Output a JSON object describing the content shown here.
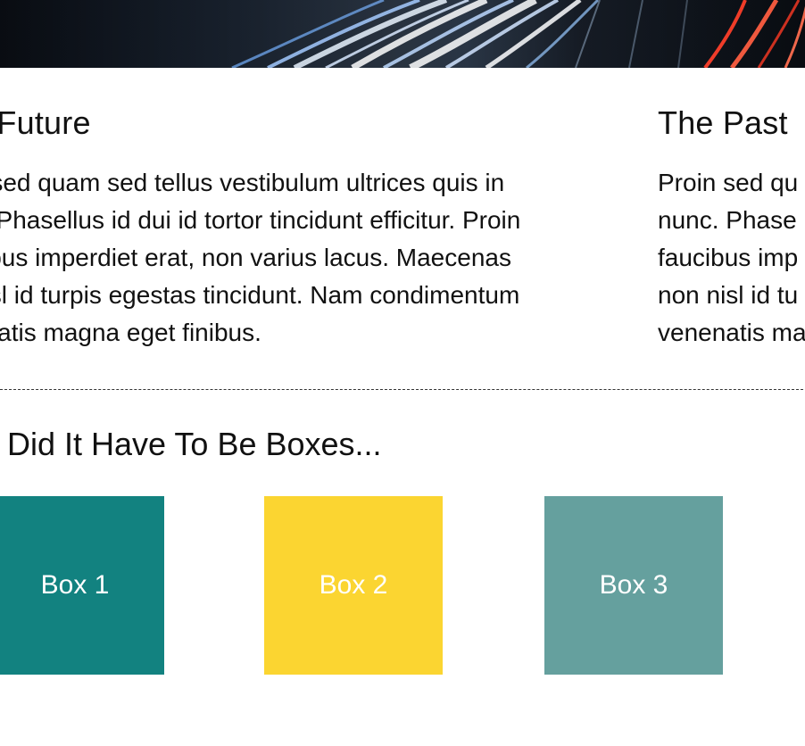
{
  "sections": [
    {
      "title": "e Future",
      "paragraph_lines": [
        "n sed quam sed tellus vestibulum ultrices quis in",
        "c. Phasellus id dui id tortor tincidunt efficitur. Proin",
        "cibus imperdiet erat, non varius lacus. Maecenas",
        " nisl id turpis egestas tincidunt. Nam condimentum",
        "enatis magna eget finibus."
      ]
    },
    {
      "title": "The Past",
      "paragraph_lines": [
        "Proin sed qu",
        "nunc. Phase",
        "faucibus imp",
        "non nisl id tu",
        "venenatis ma"
      ]
    }
  ],
  "boxes_section": {
    "title": "y Did It Have To Be Boxes...",
    "boxes": [
      {
        "label": "Box 1",
        "color": "#128280"
      },
      {
        "label": "Box 2",
        "color": "#fbd531"
      },
      {
        "label": "Box 3",
        "color": "#65a09e"
      }
    ]
  },
  "colors": {
    "text": "#111111",
    "background": "#ffffff",
    "divider": "#333333"
  }
}
